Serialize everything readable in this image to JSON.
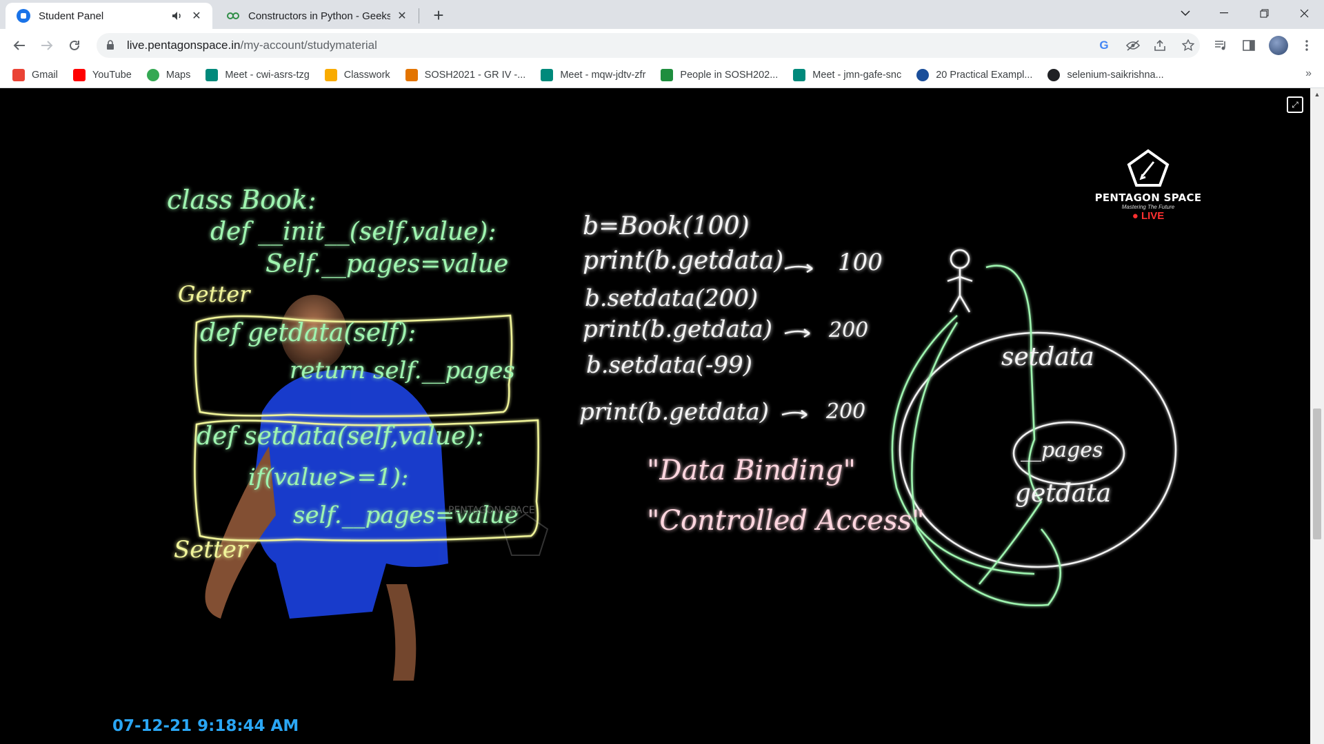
{
  "browser": {
    "tabs": [
      {
        "title": "Student Panel",
        "active": true,
        "favicon": "student-panel-favicon",
        "audio": true
      },
      {
        "title": "Constructors in Python - GeeksforGeeks",
        "active": false,
        "favicon": "geeksforgeeks-favicon"
      }
    ],
    "url_host": "live.pentagonspace.in",
    "url_path": "/my-account/studymaterial",
    "bookmarks": [
      {
        "label": "Gmail",
        "icon": "gmail-icon",
        "color": "#ea4335"
      },
      {
        "label": "YouTube",
        "icon": "youtube-icon",
        "color": "#ff0000"
      },
      {
        "label": "Maps",
        "icon": "maps-icon",
        "color": "#34a853"
      },
      {
        "label": "Meet - cwi-asrs-tzg",
        "icon": "meet-icon",
        "color": "#00897b"
      },
      {
        "label": "Classwork",
        "icon": "classwork-icon",
        "color": "#f9ab00"
      },
      {
        "label": "SOSH2021 - GR IV -...",
        "icon": "sosh-icon",
        "color": "#e37400"
      },
      {
        "label": "Meet - mqw-jdtv-zfr",
        "icon": "meet-icon",
        "color": "#00897b"
      },
      {
        "label": "People in SOSH202...",
        "icon": "classroom-icon",
        "color": "#1e8e3e"
      },
      {
        "label": "Meet - jmn-gafe-snc",
        "icon": "meet-icon",
        "color": "#00897b"
      },
      {
        "label": "20 Practical Exampl...",
        "icon": "shield-icon",
        "color": "#1a4e9a"
      },
      {
        "label": "selenium-saikrishna...",
        "icon": "github-icon",
        "color": "#202124"
      }
    ]
  },
  "board": {
    "left_code": [
      "class Book:",
      "def __init__(self,value):",
      "Self.__pages=value",
      "Getter",
      "def getdata(self):",
      "return self.__pages",
      "def setdata(self,value):",
      "if(value>=1):",
      "self.__pages=value",
      "Setter"
    ],
    "middle_code": [
      "b=Book(100)",
      "print(b.getdata)",
      "100",
      "b.setdata(200)",
      "print(b.getdata)",
      "200",
      "b.setdata(-99)",
      "print(b.getdata)",
      "200"
    ],
    "quotes": [
      "\"Data Binding\"",
      "\"Controlled Access\""
    ],
    "diagram": {
      "outer": "setdata",
      "inner": "__pages",
      "lower": "getdata"
    }
  },
  "logo": {
    "name": "PENTAGON SPACE",
    "tagline": "Mastering The Future",
    "live": "LIVE"
  },
  "watermark": "PENTAGON SPACE",
  "timestamp": "07-12-21 9:18:44 AM"
}
